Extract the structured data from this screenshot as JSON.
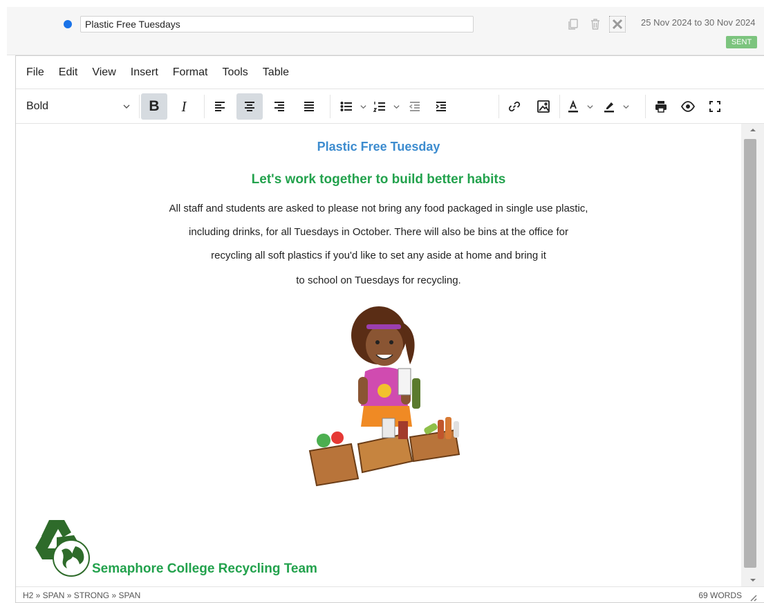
{
  "header": {
    "title_value": "Plastic Free Tuesdays",
    "date_range": "25 Nov 2024 to 30 Nov 2024",
    "status_badge": "SENT",
    "icons": [
      "copy-icon",
      "trash-icon",
      "close-icon"
    ]
  },
  "menubar": {
    "items": [
      "File",
      "Edit",
      "View",
      "Insert",
      "Format",
      "Tools",
      "Table"
    ]
  },
  "toolbar": {
    "block_format": "Bold",
    "bold_label": "B",
    "italic_label": "I",
    "active_buttons": [
      "bold",
      "align-center"
    ]
  },
  "content": {
    "title": "Plastic Free Tuesday",
    "subtitle": "Let's work together to build better habits",
    "paragraph_lines": [
      "All staff and students are asked to please not bring any food packaged in single use plastic,",
      "including drinks, for all Tuesdays in October. There will also be bins at the office for",
      "recycling all soft plastics if you'd like to set any aside at home and bring it",
      "to school on Tuesdays for recycling."
    ],
    "team_name": "Semaphore College Recycling Team"
  },
  "statusbar": {
    "element_path": "H2 » SPAN » STRONG » SPAN",
    "word_count": "69 WORDS"
  },
  "colors": {
    "accent_blue": "#1a73e8",
    "title_blue": "#3d8ccf",
    "heading_green": "#23a24d",
    "badge_green": "#7cc47e",
    "logo_green": "#2e6b2a"
  }
}
